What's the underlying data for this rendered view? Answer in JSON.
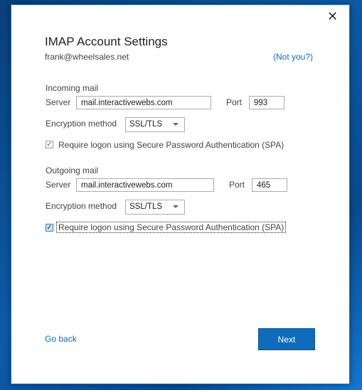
{
  "dialog": {
    "close_icon": "close-icon",
    "title": "IMAP Account Settings",
    "email": "frank@wheelsales.net",
    "not_you": "(Not you?)"
  },
  "incoming": {
    "heading": "Incoming mail",
    "server_label": "Server",
    "server_value": "mail.interactivewebs.com",
    "port_label": "Port",
    "port_value": "993",
    "encryption_label": "Encryption method",
    "encryption_value": "SSL/TLS",
    "spa_label": "Require logon using Secure Password Authentication (SPA)",
    "spa_checked": true
  },
  "outgoing": {
    "heading": "Outgoing mail",
    "server_label": "Server",
    "server_value": "mail.interactivewebs.com",
    "port_label": "Port",
    "port_value": "465",
    "encryption_label": "Encryption method",
    "encryption_value": "SSL/TLS",
    "spa_label": "Require logon using Secure Password Authentication (SPA)",
    "spa_checked": true
  },
  "footer": {
    "go_back": "Go back",
    "next": "Next"
  },
  "colors": {
    "accent": "#0f6cbd",
    "desktop": "#0d5ba8"
  }
}
